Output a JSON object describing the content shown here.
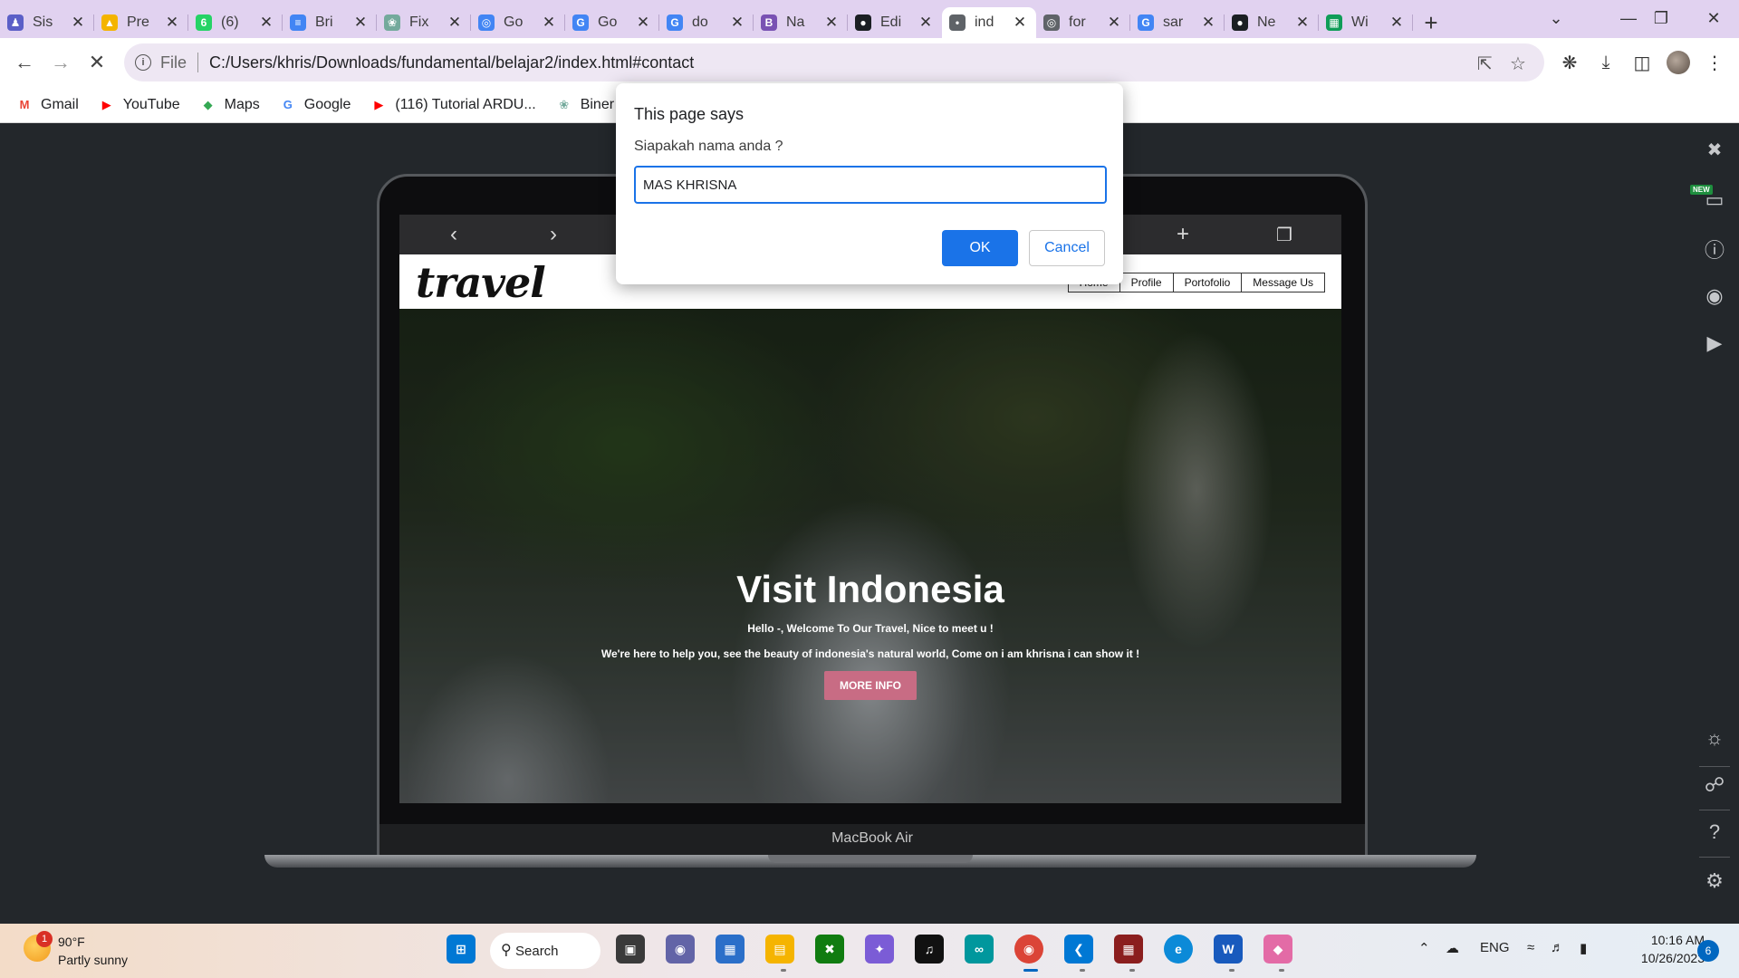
{
  "tabs": [
    {
      "title": "Sis",
      "icon": "teams-icon",
      "color": "#5b5fc7",
      "glyph": "♟"
    },
    {
      "title": "Pre",
      "icon": "drive-icon",
      "color": "#f4b400",
      "glyph": "▲"
    },
    {
      "title": "(6)",
      "icon": "whatsapp-icon",
      "color": "#25d366",
      "glyph": "6"
    },
    {
      "title": "Bri",
      "icon": "docs-icon",
      "color": "#4285f4",
      "glyph": "≡"
    },
    {
      "title": "Fix",
      "icon": "chatgpt-icon",
      "color": "#74aa9c",
      "glyph": "❀"
    },
    {
      "title": "Go",
      "icon": "google-lens-icon",
      "color": "#4285f4",
      "glyph": "◎"
    },
    {
      "title": "Go",
      "icon": "google-translate-icon",
      "color": "#4285f4",
      "glyph": "G"
    },
    {
      "title": "do",
      "icon": "google-icon",
      "color": "#4285f4",
      "glyph": "G"
    },
    {
      "title": "Na",
      "icon": "bootstrap-icon",
      "color": "#7952b3",
      "glyph": "B"
    },
    {
      "title": "Edi",
      "icon": "github-icon",
      "color": "#1b1f23",
      "glyph": "●"
    },
    {
      "title": "ind",
      "icon": "loading-icon",
      "color": "#5f6368",
      "glyph": "•"
    },
    {
      "title": "for",
      "icon": "globe-icon",
      "color": "#5f6368",
      "glyph": "◎"
    },
    {
      "title": "sar",
      "icon": "google-icon",
      "color": "#4285f4",
      "glyph": "G"
    },
    {
      "title": "Ne",
      "icon": "github-icon",
      "color": "#1b1f23",
      "glyph": "●"
    },
    {
      "title": "Wi",
      "icon": "sheets-icon",
      "color": "#0f9d58",
      "glyph": "▦"
    }
  ],
  "toolbar": {
    "scheme": "File",
    "url": "C:/Users/khris/Downloads/fundamental/belajar2/index.html#contact"
  },
  "bookmarks": [
    {
      "label": "Gmail",
      "icon": "gmail-icon",
      "color": "#ea4335",
      "glyph": "M"
    },
    {
      "label": "YouTube",
      "icon": "youtube-icon",
      "color": "#ff0000",
      "glyph": "▶"
    },
    {
      "label": "Maps",
      "icon": "maps-icon",
      "color": "#34a853",
      "glyph": "◆"
    },
    {
      "label": "Google",
      "icon": "google-icon",
      "color": "#4285f4",
      "glyph": "G"
    },
    {
      "label": "(116) Tutorial ARDU...",
      "icon": "youtube-icon",
      "color": "#ff0000",
      "glyph": "▶"
    },
    {
      "label": "Biner Bas",
      "icon": "chatgpt-icon",
      "color": "#74aa9c",
      "glyph": "❀"
    }
  ],
  "site": {
    "logo": "travel",
    "nav": [
      "Home",
      "Profile",
      "Portofolio",
      "Message Us"
    ],
    "hero_title": "Visit Indonesia",
    "hero_sub": "Hello -, Welcome To Our Travel, Nice to meet u !",
    "hero_text": "We're here to help you, see the beauty of indonesia's natural world, Come on i am khrisna i can show it !",
    "hero_button": "MORE INFO",
    "accent": "#c86c84"
  },
  "device": {
    "label": "MacBook Air",
    "new_badge": "NEW"
  },
  "dialog": {
    "title": "This page says",
    "message": "Siapakah nama anda ?",
    "input_value": "MAS KHRISNA",
    "ok": "OK",
    "cancel": "Cancel"
  },
  "taskbar": {
    "temp": "90°F",
    "weather": "Partly sunny",
    "weather_badge": "1",
    "search": "Search",
    "lang": "ENG",
    "time": "10:16 AM",
    "date": "10/26/2023",
    "notifications": "6"
  }
}
